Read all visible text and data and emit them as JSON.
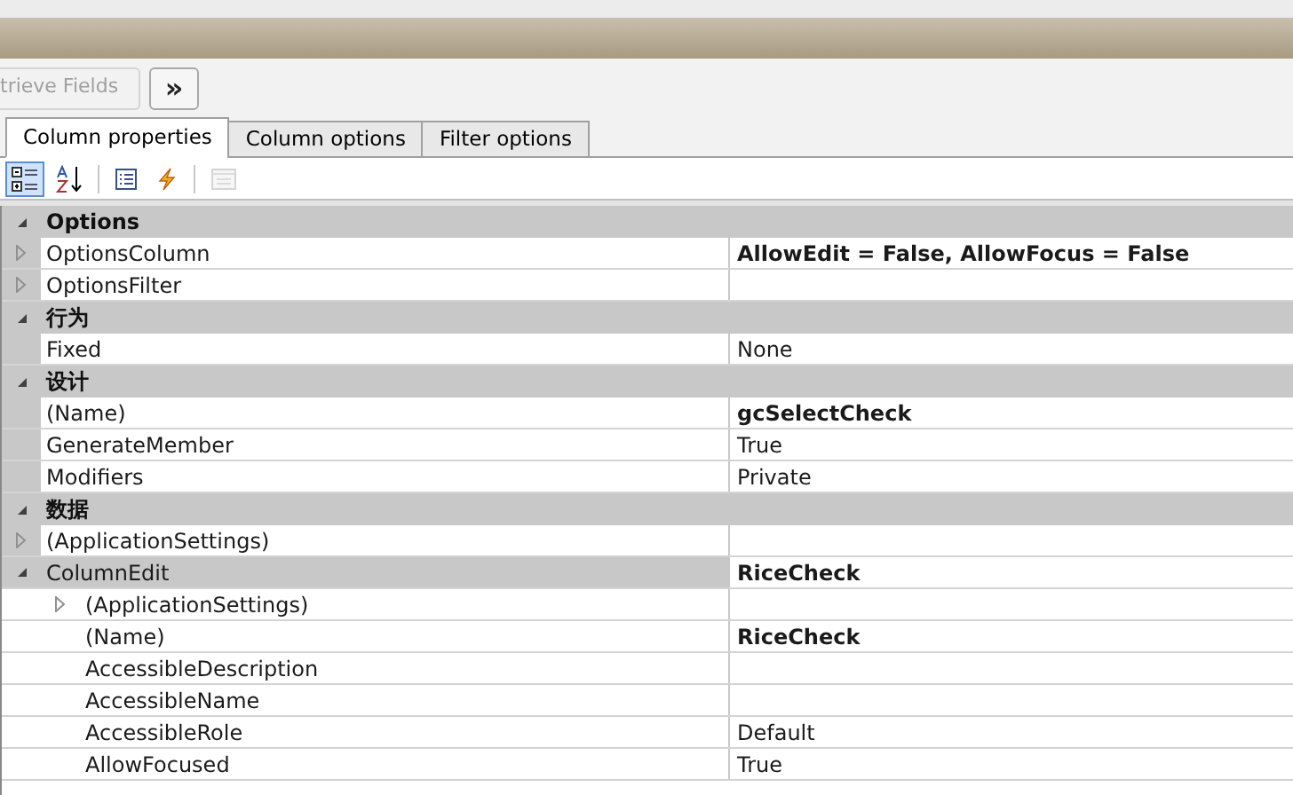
{
  "toolbar": {
    "retrieve_button": {
      "label": "trieve Fields",
      "disabled": true
    },
    "more_button": {
      "label": "»"
    }
  },
  "tabs": [
    {
      "label": "Column properties",
      "selected": true
    },
    {
      "label": "Column options",
      "selected": false
    },
    {
      "label": "Filter options",
      "selected": false
    }
  ],
  "grid_tools": [
    {
      "kind": "categorized",
      "selected": true,
      "disabled": false
    },
    {
      "kind": "alphabetical",
      "selected": false,
      "disabled": false
    },
    {
      "kind": "properties",
      "selected": false,
      "disabled": false
    },
    {
      "kind": "events",
      "selected": false,
      "disabled": false
    },
    {
      "kind": "pages",
      "selected": false,
      "disabled": true
    }
  ],
  "categories": [
    {
      "label": "Options",
      "expanded": true,
      "properties": [
        {
          "name": "OptionsColumn",
          "value": "AllowEdit = False, AllowFocus = False",
          "bold": true,
          "expanded": false
        },
        {
          "name": "OptionsFilter",
          "expanded": false
        }
      ]
    },
    {
      "label": "行为",
      "expanded": true,
      "properties": [
        {
          "name": "Fixed",
          "value": "None",
          "bold": false
        }
      ]
    },
    {
      "label": "设计",
      "expanded": true,
      "properties": [
        {
          "name": "(Name)",
          "value": "gcSelectCheck",
          "bold": true
        },
        {
          "name": "GenerateMember",
          "value": "True",
          "bold": false
        },
        {
          "name": "Modifiers",
          "value": "Private",
          "bold": false
        }
      ]
    },
    {
      "label": "数据",
      "expanded": true,
      "properties": [
        {
          "name": "(ApplicationSettings)",
          "expanded": false
        },
        {
          "name": "ColumnEdit",
          "value": "RiceCheck",
          "bold": true,
          "expanded": true,
          "children": [
            {
              "name": "(ApplicationSettings)",
              "expanded": false
            },
            {
              "name": "(Name)",
              "value": "RiceCheck",
              "bold": true
            },
            {
              "name": "AccessibleDescription"
            },
            {
              "name": "AccessibleName"
            },
            {
              "name": "AccessibleRole",
              "value": "Default",
              "bold": false
            },
            {
              "name": "AllowFocused",
              "value": "True",
              "bold": false
            }
          ]
        }
      ]
    }
  ]
}
